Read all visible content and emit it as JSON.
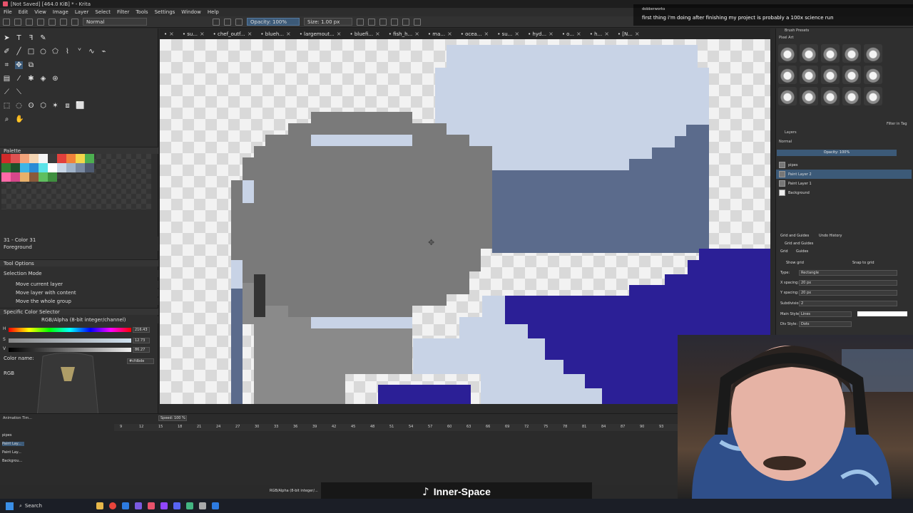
{
  "window": {
    "title": "[Not Saved] [464.0 KiB] * - Krita"
  },
  "menu": [
    "File",
    "Edit",
    "View",
    "Image",
    "Layer",
    "Select",
    "Filter",
    "Tools",
    "Settings",
    "Window",
    "Help"
  ],
  "toolbar": {
    "blend_mode": "Normal",
    "opacity": "Opacity: 100%",
    "size": "Size: 1.00 px"
  },
  "tabs": [
    "•",
    "• su...",
    "• chef_outf...",
    "• blueh...",
    "• largemout...",
    "• bluefi...",
    "• fish_h...",
    "• ma...",
    "• ocea...",
    "• su...",
    "• hyd...",
    "• o...",
    "• h...",
    "• [N..."
  ],
  "left": {
    "palette_title": "Palette",
    "palette_selected": "31 - Color 31",
    "palette_fg": "Foreground",
    "tool_options_title": "Tool Options",
    "selection_mode": "Selection Mode",
    "move_options": [
      "Move current layer",
      "Move layer with content",
      "Move the whole group"
    ],
    "color_selector_title": "Specific Color Selector",
    "color_model": "RGB/Alpha (8-bit integer/channel)",
    "h_label": "H",
    "s_label": "S",
    "v_label": "V",
    "h_value": "216.43",
    "s_value": "12.73",
    "v_value": "86.27",
    "color_name_label": "Color name:",
    "hex_value": "#cfdbde",
    "rgb_label": "RGB"
  },
  "palette_colors": [
    "#d22a2a",
    "#e05252",
    "#f2a37a",
    "#f4d5b3",
    "#f5f5f5",
    "#3b3b3b",
    "#e2403c",
    "#f0823a",
    "#f3d64a",
    "#4caf50",
    "#2e7d32",
    "#1f4f2a",
    "#3db5e6",
    "#2b8cd6",
    "#5be3e8",
    "#ffffff",
    "#c8d6e6",
    "#9fb2c8",
    "#7888a0",
    "#4e5a70",
    "#ff6aa8",
    "#d6478a",
    "#e8b06a",
    "#8a5a3a",
    "#5fbf5f",
    "#3f8f3f"
  ],
  "timeline": {
    "title": "Animation Tim...",
    "speed": "Speed: 100 %",
    "frames": [
      "9",
      "12",
      "15",
      "18",
      "21",
      "24",
      "27",
      "30",
      "33",
      "36",
      "39",
      "42",
      "45",
      "48",
      "51",
      "54",
      "57",
      "60",
      "63",
      "66",
      "69",
      "72",
      "75",
      "78",
      "81",
      "84",
      "87",
      "90",
      "93"
    ],
    "layers": [
      "pipes",
      "Paint Lay...",
      "Paint Lay...",
      "Backgrou..."
    ]
  },
  "right": {
    "brush_presets_title": "Brush Presets",
    "brush_tag": "Pixel Art",
    "filter_label": "Filter in Tag",
    "layers_title": "Layers",
    "layers_blend": "Normal",
    "layers_opacity": "Opacity: 100%",
    "layers": [
      "pipes",
      "Paint Layer 2",
      "Paint Layer 1",
      "Background"
    ],
    "grid_tabs": [
      "Grid and Guides",
      "Undo History"
    ],
    "grid_title": "Grid and Guides",
    "grid_subtabs": [
      "Grid",
      "Guides"
    ],
    "show_grid": "Show grid",
    "snap_grid": "Snap to grid",
    "type_label": "Type:",
    "type_value": "Rectangle",
    "xspacing_label": "X spacing:",
    "xspacing_value": "20 px",
    "yspacing_label": "Y spacing:",
    "yspacing_value": "20 px",
    "subdiv_label": "Subdivision:",
    "subdiv_value": "2",
    "mainstyle_label": "Main Style:",
    "mainstyle_value": "Lines",
    "divstyle_label": "Div Style:",
    "divstyle_value": "Dots"
  },
  "chat": {
    "user": "dobberworks",
    "message": "first thing i'm doing after finishing my project is probably a 100x science run"
  },
  "music": {
    "track": "Inner-Space"
  },
  "status": {
    "text": "RGB/Alpha (8-bit integer/..."
  },
  "taskbar": {
    "search": "Search"
  },
  "colors": {
    "accent": "#3c5a78",
    "canvas_dark_blue": "#2b1f96",
    "canvas_slate": "#5b6b8c",
    "canvas_light": "#c8d3e6",
    "canvas_gray": "#7a7a7a"
  }
}
